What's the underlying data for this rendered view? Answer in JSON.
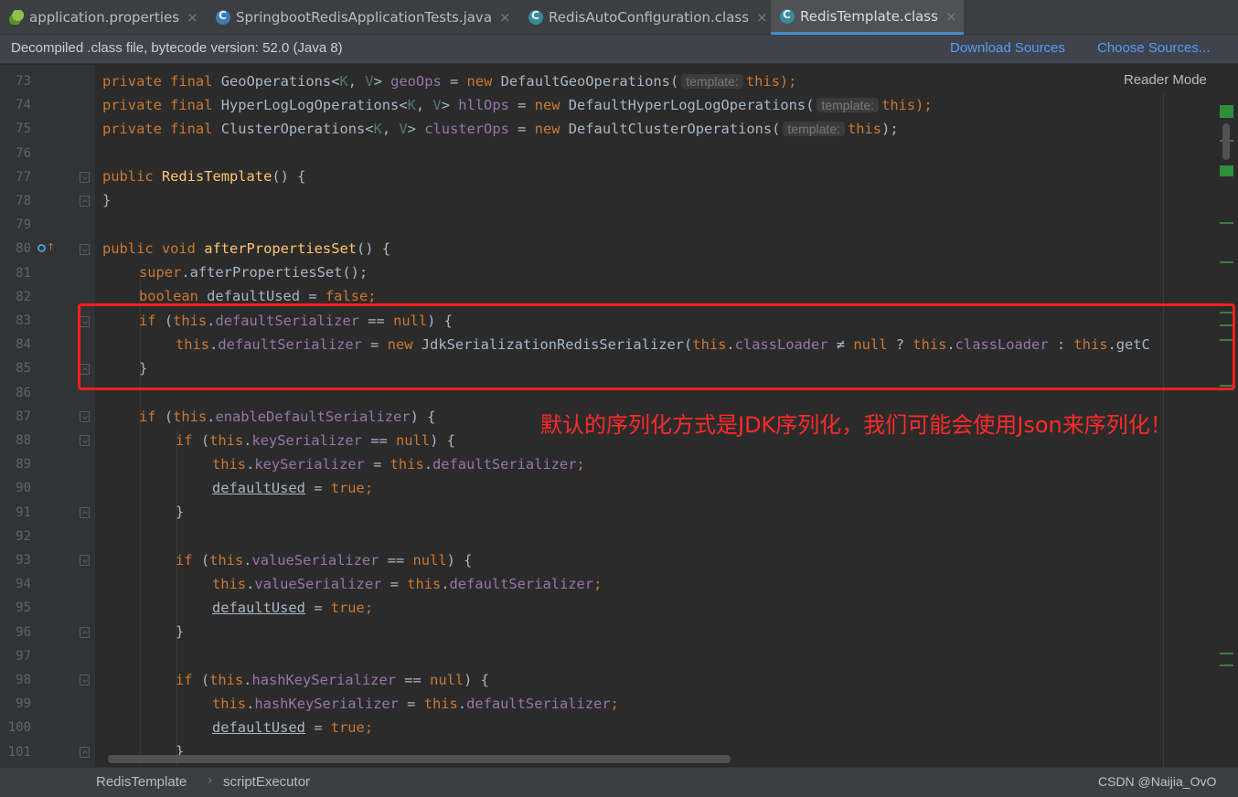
{
  "tabs": [
    {
      "label": "application.properties",
      "icon": "spring-leaf-icon",
      "active": false
    },
    {
      "label": "SpringbootRedisApplicationTests.java",
      "icon": "java-class-icon",
      "active": false
    },
    {
      "label": "RedisAutoConfiguration.class",
      "icon": "compiled-class-icon",
      "active": false
    },
    {
      "label": "RedisTemplate.class",
      "icon": "compiled-class-icon",
      "active": true
    }
  ],
  "tab_close_glyph": "×",
  "infobar": {
    "text": "Decompiled .class file, bytecode version: 52.0 (Java 8)",
    "download_sources": "Download Sources",
    "choose_sources": "Choose Sources..."
  },
  "editor": {
    "reader_mode": "Reader Mode",
    "line_numbers": [
      "73",
      "74",
      "75",
      "76",
      "77",
      "78",
      "79",
      "80",
      "81",
      "82",
      "83",
      "84",
      "85",
      "86",
      "87",
      "88",
      "89",
      "90",
      "91",
      "92",
      "93",
      "94",
      "95",
      "96",
      "97",
      "98",
      "99",
      "100",
      "101"
    ],
    "code": {
      "l73": {
        "t1": "private final ",
        "t2": "GeoOperations<",
        "t3": "K",
        "t4": ", ",
        "t5": "V",
        "t6": "> ",
        "t7": "geoOps",
        "t8": " = ",
        "t9": "new ",
        "t10": "DefaultGeoOperations(",
        "hint": "template:",
        "t11": "this",
        "t12": ");"
      },
      "l74": {
        "t1": "private final ",
        "t2": "HyperLogLogOperations<",
        "t3": "K",
        "t4": ", ",
        "t5": "V",
        "t6": "> ",
        "t7": "hllOps",
        "t8": " = ",
        "t9": "new ",
        "t10": "DefaultHyperLogLogOperations(",
        "hint": "template:",
        "t11": "this",
        "t12": ");"
      },
      "l75": {
        "t1": "private final ",
        "t2": "ClusterOperations<",
        "t3": "K",
        "t4": ", ",
        "t5": "V",
        "t6": "> ",
        "t7": "clusterOps",
        "t8": " = ",
        "t9": "new ",
        "t10": "DefaultClusterOperations(",
        "hint": "template:",
        "t11": "this",
        "t12": ");"
      },
      "l77": {
        "t1": "public ",
        "t2": "RedisTemplate",
        "t3": "() {"
      },
      "l78": {
        "t1": "}"
      },
      "l80": {
        "t1": "public void ",
        "t2": "afterPropertiesSet",
        "t3": "() {"
      },
      "l81": {
        "t1": "super",
        "t2": ".afterPropertiesSet();"
      },
      "l82": {
        "t1": "boolean ",
        "t2": "defaultUsed",
        "t3": " = ",
        "t4": "false",
        "t5": ";"
      },
      "l83": {
        "t1": "if ",
        "t2": "(",
        "t3": "this",
        "t4": ".",
        "t5": "defaultSerializer",
        "t6": " == ",
        "t7": "null",
        "t8": ") {"
      },
      "l84": {
        "t1": "this",
        "t2": ".",
        "t3": "defaultSerializer",
        "t4": " = ",
        "t5": "new ",
        "t6": "JdkSerializationRedisSerializer(",
        "t7": "this",
        "t8": ".",
        "t9": "classLoader",
        "t10": " ≠ ",
        "t11": "null",
        "t12": " ? ",
        "t13": "this",
        "t14": ".",
        "t15": "classLoader",
        "t16": " : ",
        "t17": "this",
        "t18": ".getC"
      },
      "l85": {
        "t1": "}"
      },
      "l87": {
        "t1": "if ",
        "t2": "(",
        "t3": "this",
        "t4": ".",
        "t5": "enableDefaultSerializer",
        "t6": ") {"
      },
      "l88": {
        "t1": "if ",
        "t2": "(",
        "t3": "this",
        "t4": ".",
        "t5": "keySerializer",
        "t6": " == ",
        "t7": "null",
        "t8": ") {"
      },
      "l89": {
        "t1": "this",
        "t2": ".",
        "t3": "keySerializer",
        "t4": " = ",
        "t5": "this",
        "t6": ".",
        "t7": "defaultSerializer",
        "t8": ";"
      },
      "l90": {
        "t1": "defaultUsed",
        "t2": " = ",
        "t3": "true",
        "t4": ";"
      },
      "l91": {
        "t1": "}"
      },
      "l93": {
        "t1": "if ",
        "t2": "(",
        "t3": "this",
        "t4": ".",
        "t5": "valueSerializer",
        "t6": " == ",
        "t7": "null",
        "t8": ") {"
      },
      "l94": {
        "t1": "this",
        "t2": ".",
        "t3": "valueSerializer",
        "t4": " = ",
        "t5": "this",
        "t6": ".",
        "t7": "defaultSerializer",
        "t8": ";"
      },
      "l95": {
        "t1": "defaultUsed",
        "t2": " = ",
        "t3": "true",
        "t4": ";"
      },
      "l96": {
        "t1": "}"
      },
      "l98": {
        "t1": "if ",
        "t2": "(",
        "t3": "this",
        "t4": ".",
        "t5": "hashKeySerializer",
        "t6": " == ",
        "t7": "null",
        "t8": ") {"
      },
      "l99": {
        "t1": "this",
        "t2": ".",
        "t3": "hashKeySerializer",
        "t4": " = ",
        "t5": "this",
        "t6": ".",
        "t7": "defaultSerializer",
        "t8": ";"
      },
      "l100": {
        "t1": "defaultUsed",
        "t2": " = ",
        "t3": "true",
        "t4": ";"
      },
      "l101": {
        "t1": "}"
      }
    }
  },
  "annotation": "默认的序列化方式是JDK序列化，我们可能会使用Json来序列化！",
  "breadcrumb": {
    "item1": "RedisTemplate",
    "separator": "›",
    "item2": "scriptExecutor"
  },
  "watermark": "CSDN @Naijia_OvO",
  "colors": {
    "keyword": "#cc7832",
    "method": "#ffc66d",
    "field": "#9876aa",
    "annotation_red": "#ff1f1f",
    "link": "#589df6"
  }
}
